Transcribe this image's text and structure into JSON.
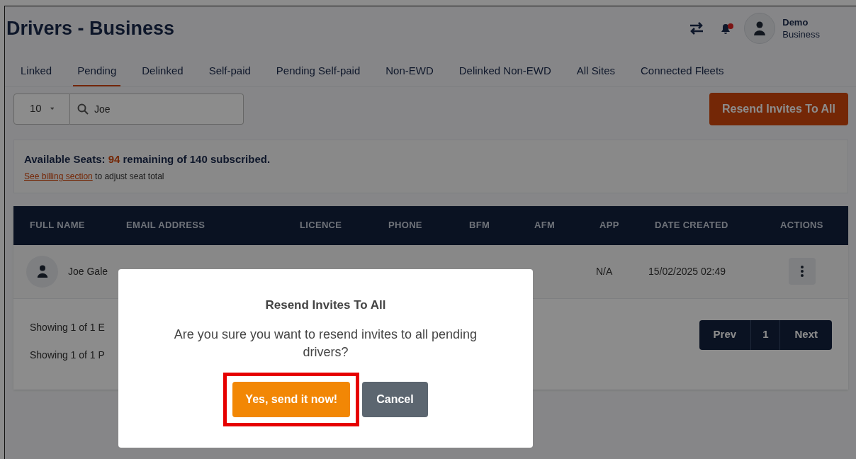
{
  "header": {
    "title": "Drivers - Business",
    "notification_unread": true,
    "user": {
      "name": "Demo",
      "role": "Business"
    }
  },
  "tabs": [
    {
      "label": "Linked",
      "selected": false
    },
    {
      "label": "Pending",
      "selected": true
    },
    {
      "label": "Delinked",
      "selected": false
    },
    {
      "label": "Self-paid",
      "selected": false
    },
    {
      "label": "Pending Self-paid",
      "selected": false
    },
    {
      "label": "Non-EWD",
      "selected": false
    },
    {
      "label": "Delinked Non-EWD",
      "selected": false
    },
    {
      "label": "All Sites",
      "selected": false
    },
    {
      "label": "Connected Fleets",
      "selected": false
    }
  ],
  "toolbar": {
    "page_size": "10",
    "search": "Joe",
    "resend_button": "Resend Invites To All"
  },
  "seats": {
    "label": "Available Seats:",
    "remaining": "94",
    "rest": "remaining of 140 subscribed.",
    "link": "See billing section",
    "note": "to adjust seat total"
  },
  "table": {
    "columns": [
      "FULL NAME",
      "EMAIL ADDRESS",
      "LICENCE",
      "PHONE",
      "BFM",
      "AFM",
      "APP",
      "DATE CREATED",
      "ACTIONS"
    ],
    "rows": [
      {
        "full_name": "Joe Gale",
        "app": "N/A",
        "date_created": "15/02/2025 02:49"
      }
    ],
    "footer": [
      "Showing 1 of 1 E",
      "Showing 1 of 1 P"
    ],
    "pagination": {
      "prev": "Prev",
      "page": "1",
      "next": "Next"
    }
  },
  "dialog": {
    "title": "Resend Invites To All",
    "message": "Are you sure you want to resend invites to all pending drivers?",
    "confirm": "Yes, send it now!",
    "cancel": "Cancel",
    "confirm_highlighted": true
  }
}
